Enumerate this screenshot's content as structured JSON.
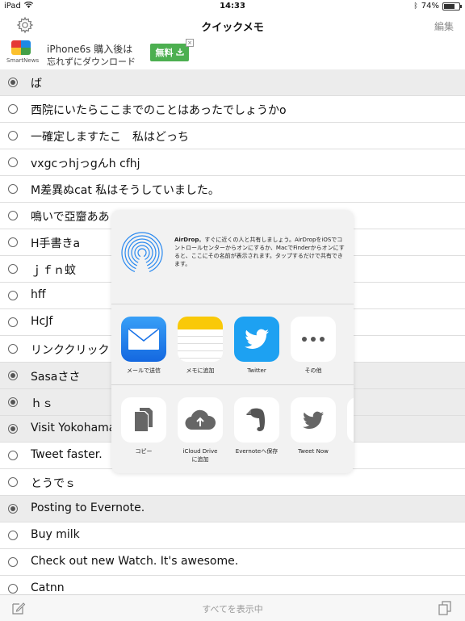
{
  "status_bar": {
    "device": "iPad",
    "time": "14:33",
    "battery": "74%",
    "battery_level": 0.74
  },
  "nav": {
    "title": "クイックメモ",
    "edit_label": "編集"
  },
  "ad": {
    "brand": "SmartNews",
    "line1": "iPhone6s 購入後は",
    "line2": "忘れずにダウンロード",
    "cta": "無料",
    "close": "×"
  },
  "memos": [
    {
      "text": "ば",
      "selected": true
    },
    {
      "text": "西院にいたらここまでのことはあったでしょうかo",
      "selected": false
    },
    {
      "text": "一確定しますたこ　私はどっち",
      "selected": false
    },
    {
      "text": "vxgcっhjっgんh cfhj",
      "selected": false
    },
    {
      "text": "M差異ぬcat 私はそうしていました。",
      "selected": false
    },
    {
      "text": "鳴いで亞齏ああ",
      "selected": false
    },
    {
      "text": "H手書きa",
      "selected": false
    },
    {
      "text": "ｊｆｎ蚊",
      "selected": false
    },
    {
      "text": "hff",
      "selected": false
    },
    {
      "text": "HcJf",
      "selected": false
    },
    {
      "text": "リンククリック",
      "selected": false
    },
    {
      "text": "Sasaささ",
      "selected": true
    },
    {
      "text": "ｈｓ",
      "selected": true
    },
    {
      "text": "Visit Yokohama",
      "selected": true
    },
    {
      "text": "Tweet faster.",
      "selected": false
    },
    {
      "text": "とうでｓ",
      "selected": false
    },
    {
      "text": "Posting to Evernote.",
      "selected": true
    },
    {
      "text": "Buy milk",
      "selected": false
    },
    {
      "text": "Check out new Watch. It's awesome.",
      "selected": false
    },
    {
      "text": "Catnn",
      "selected": false
    }
  ],
  "share_sheet": {
    "airdrop_title": "AirDrop",
    "airdrop_desc": "。すぐに近くの人と共有しましょう。AirDropをiOSでコントロールセンターからオンにするか、MacでFinderからオンにすると、ここにその名前が表示されます。タップするだけで共有できます。",
    "apps": [
      {
        "label": "メールで送信",
        "icon": "mail-icon"
      },
      {
        "label": "メモに追加",
        "icon": "notes-icon"
      },
      {
        "label": "Twitter",
        "icon": "twitter-icon"
      },
      {
        "label": "その他",
        "icon": "more-icon"
      }
    ],
    "actions": [
      {
        "label": "コピー",
        "icon": "copy-icon"
      },
      {
        "label": "iCloud Drive\nに追加",
        "icon": "icloud-icon"
      },
      {
        "label": "Evernoteへ保存",
        "icon": "evernote-icon"
      },
      {
        "label": "Tweet Now",
        "icon": "twitter-bird-icon"
      }
    ]
  },
  "toolbar": {
    "show_all": "すべてを表示中"
  },
  "colors": {
    "ad_cta": "#4caf50",
    "mail": "#1e88e5",
    "twitter": "#1da1f2",
    "notes": "#f9c908"
  }
}
